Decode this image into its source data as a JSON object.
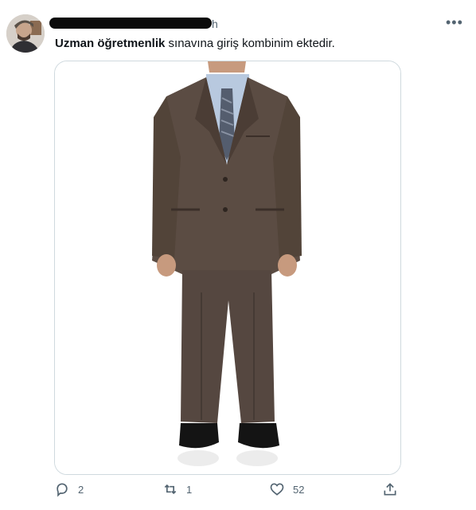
{
  "tweet": {
    "timestamp": "h",
    "text_bold": "Uzman öğretmenlik",
    "text_rest": " sınavına giriş kombinim ektedir.",
    "more_label": "•••"
  },
  "actions": {
    "reply_count": "2",
    "retweet_count": "1",
    "like_count": "52"
  },
  "icons": [
    "reply-icon",
    "retweet-icon",
    "like-icon",
    "share-icon",
    "more-icon"
  ],
  "colors": {
    "text_primary": "#0f1419",
    "text_secondary": "#536471",
    "border": "#cfd9de",
    "suit": "#5b4c43",
    "shirt": "#b8c9df"
  }
}
